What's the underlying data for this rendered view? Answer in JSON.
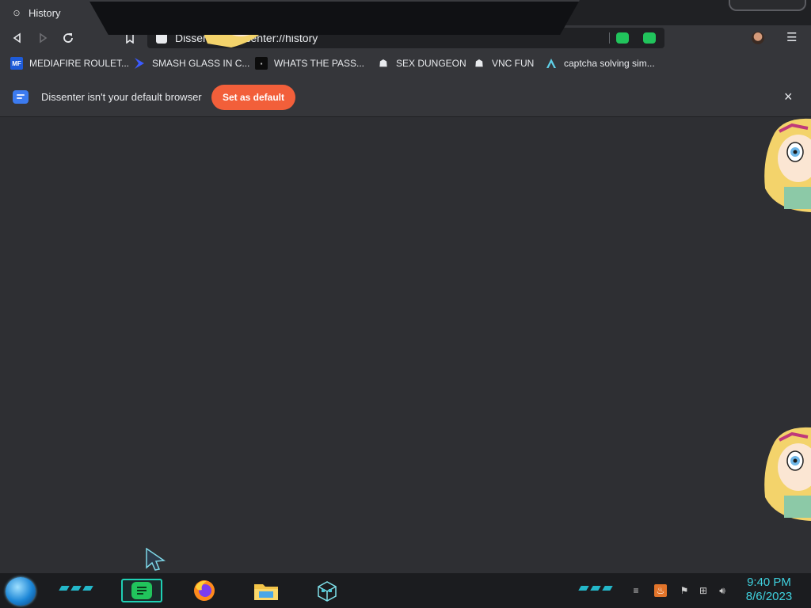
{
  "browser": {
    "tab": {
      "title": "History",
      "close_glyph": "×"
    },
    "address_bar": {
      "url_text": "Dissenter | dissenter://history"
    },
    "bookmarks": [
      {
        "label": "MEDIAFIRE ROULET...",
        "icon": "mediafire-icon",
        "icon_text": "MF"
      },
      {
        "label": "SMASH GLASS IN C...",
        "icon": "arrow-chevron-icon",
        "icon_text": ""
      },
      {
        "label": "WHATS THE PASS...",
        "icon": "terminal-icon",
        "icon_text": ""
      },
      {
        "label": "SEX DUNGEON",
        "icon": "mask-icon",
        "icon_text": ""
      },
      {
        "label": "VNC FUN",
        "icon": "mask-icon",
        "icon_text": ""
      },
      {
        "label": "captcha solving sim...",
        "icon": "triangle-logo-icon",
        "icon_text": ""
      }
    ],
    "infobar": {
      "message": "Dissenter isn't your default browser",
      "button_label": "Set as default",
      "close_glyph": "×"
    }
  },
  "taskbar": {
    "apps": [
      {
        "name": "Dissenter",
        "icon": "dissenter-icon",
        "active": true
      },
      {
        "name": "Firefox",
        "icon": "firefox-icon",
        "active": false
      },
      {
        "name": "File Explorer",
        "icon": "folder-icon",
        "active": false
      },
      {
        "name": "Cube app",
        "icon": "cube-icon",
        "active": false
      }
    ],
    "tray": [
      "network-speed-icon",
      "java-icon",
      "flag-icon",
      "network-icon",
      "volume-icon"
    ],
    "clock": {
      "time": "9:40 PM",
      "date": "8/6/2023"
    }
  },
  "colors": {
    "accent": "#f25f3a",
    "dissenter_green": "#21c45c",
    "clock_cyan": "#3fd1de",
    "content_bg": "#2e2f33"
  }
}
